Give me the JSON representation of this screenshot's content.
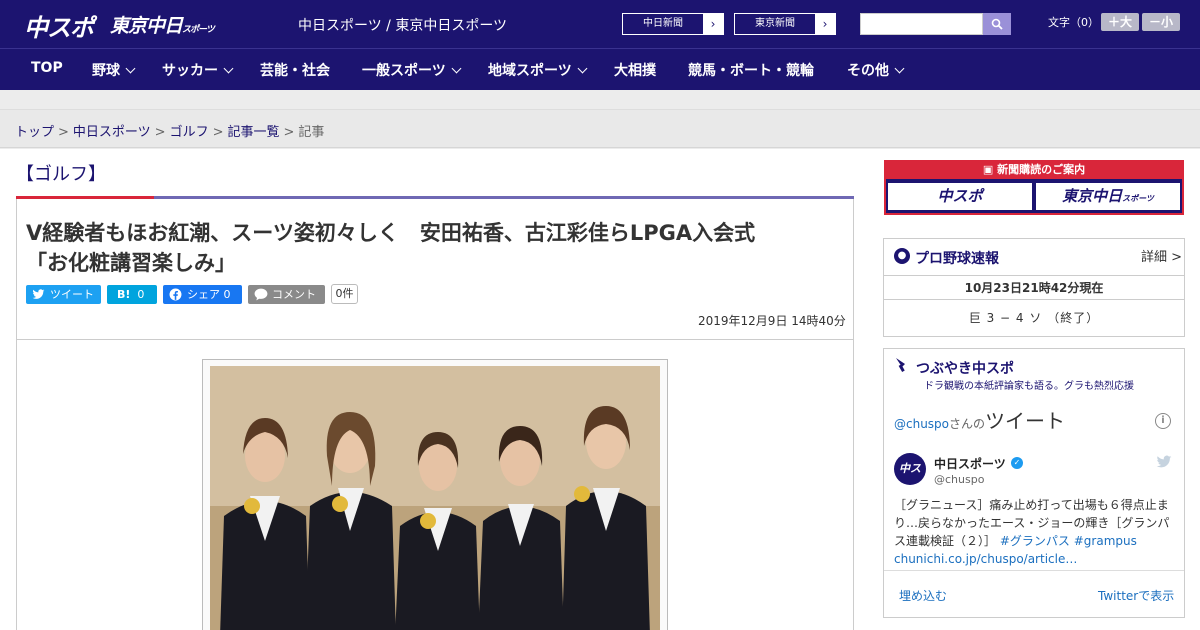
{
  "header": {
    "logo_chuspo": "中スポ",
    "logo_tokyo": "東京中日",
    "logo_tokyo_small": "スポーツ",
    "site_links": "中日スポーツ / 東京中日スポーツ",
    "paper_chunichi": "中日新聞",
    "paper_tokyo": "東京新聞",
    "fontsize_label": "文字（0）",
    "font_bigger": "＋大",
    "font_smaller": "－小",
    "search_placeholder": ""
  },
  "nav": {
    "items": [
      "TOP",
      "野球",
      "サッカー",
      "芸能・社会",
      "一般スポーツ",
      "地域スポーツ",
      "大相撲",
      "競馬・ボート・競輪",
      "その他"
    ]
  },
  "breadcrumb": {
    "top": "トップ",
    "chunichi": "中日スポーツ",
    "golf": "ゴルフ",
    "list": "記事一覧",
    "current": "記事",
    "sep": ">"
  },
  "article": {
    "category": "【ゴルフ】",
    "title_line1": "V経験者もほお紅潮、スーツ姿初々しく　安田祐香、古江彩佳らLPGA入会式",
    "title_line2": "「お化粧講習楽しみ」",
    "share_tweet": "ツイート",
    "share_hatena_icon": "B!",
    "share_hatena_count": "0",
    "share_facebook": "シェア 0",
    "share_comment": "コメント",
    "comment_count": "0件",
    "date": "2019年12月9日 14時40分"
  },
  "sidebar": {
    "subscription_header": "新聞購読のご案内",
    "sub_logo_chuspo": "中スポ",
    "sub_logo_tokyo": "東京中日",
    "sub_logo_tokyo_small": "スポーツ",
    "baseball_title": "プロ野球速報",
    "baseball_detail": "詳細 >",
    "baseball_time": "10月23日21時42分現在",
    "baseball_score": "巨 3 − 4 ソ （終了）",
    "tweets_title": "つぶやき中スポ",
    "tweets_sub": "ドラ観戦の本紙評論家も語る。グラも熱烈応援",
    "tw_handle": "@chuspo",
    "tw_san": "さんの",
    "tw_big": "ツイート",
    "tw_name": "中日スポーツ",
    "tw_handle2": "@chuspo",
    "tw_text": "［グラニュース］痛み止め打って出場も６得点止まり…戻らなかったエース・ジョーの輝き［グランパス連載検証（２）］",
    "tw_tag1": "#グランパス",
    "tw_tag2": "#grampus",
    "tw_link": "chunichi.co.jp/chuspo/article…",
    "tw_embed": "埋め込む",
    "tw_view": "Twitterで表示"
  },
  "colors": {
    "brand": "#1c1470",
    "accent_red": "#d9263a",
    "twitter": "#1da1f2",
    "hatena": "#00a4de",
    "facebook": "#1877f2",
    "comment": "#8a8a8a"
  }
}
